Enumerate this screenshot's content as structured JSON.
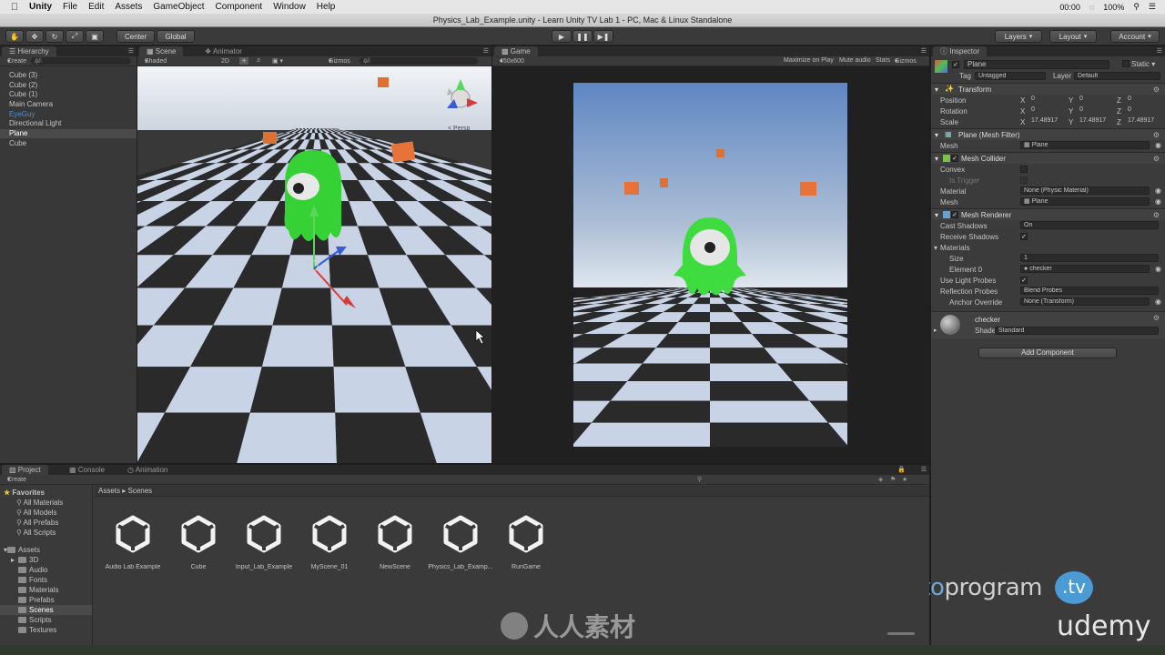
{
  "menubar": {
    "app": "Unity",
    "items": [
      "File",
      "Edit",
      "Assets",
      "GameObject",
      "Component",
      "Window",
      "Help"
    ],
    "clock": "00:00",
    "battery": "100%"
  },
  "window_title": "Physics_Lab_Example.unity - Learn Unity TV Lab 1 - PC, Mac & Linux Standalone",
  "toolbar": {
    "pivot": "Center",
    "space": "Global",
    "layers": "Layers",
    "layout": "Layout",
    "account": "Account"
  },
  "hierarchy": {
    "tab": "Hierarchy",
    "create": "Create",
    "search_placeholder": "All",
    "items": [
      "Cube (3)",
      "Cube (2)",
      "Cube (1)",
      "Main Camera",
      "EyeGuy",
      "Directional Light",
      "Plane",
      "Cube"
    ],
    "selected": "Plane",
    "prefab_item": "EyeGuy"
  },
  "scene": {
    "tabs": [
      "Scene",
      "Animator"
    ],
    "shading": "Shaded",
    "mode_2d": "2D",
    "gizmos": "Gizmos",
    "search_placeholder": "All",
    "persp": "Persp"
  },
  "game": {
    "tab": "Game",
    "resolution": "450x600",
    "options": [
      "Maximize on Play",
      "Mute audio",
      "Stats",
      "Gizmos"
    ]
  },
  "inspector": {
    "tab": "Inspector",
    "object_name": "Plane",
    "static": "Static",
    "tag_label": "Tag",
    "tag_value": "Untagged",
    "layer_label": "Layer",
    "layer_value": "Default",
    "transform": {
      "title": "Transform",
      "rows": [
        {
          "label": "Position",
          "x": "0",
          "y": "0",
          "z": "0"
        },
        {
          "label": "Rotation",
          "x": "0",
          "y": "0",
          "z": "0"
        },
        {
          "label": "Scale",
          "x": "17.48917",
          "y": "17.48917",
          "z": "17.48917"
        }
      ]
    },
    "mesh_filter": {
      "title": "Plane (Mesh Filter)",
      "mesh_label": "Mesh",
      "mesh_value": "Plane"
    },
    "mesh_collider": {
      "title": "Mesh Collider",
      "convex": "Convex",
      "is_trigger": "Is Trigger",
      "material_label": "Material",
      "material_value": "None (Physic Material)",
      "mesh_label": "Mesh",
      "mesh_value": "Plane"
    },
    "mesh_renderer": {
      "title": "Mesh Renderer",
      "cast_shadows_label": "Cast Shadows",
      "cast_shadows_value": "On",
      "receive_shadows": "Receive Shadows",
      "materials": "Materials",
      "size_label": "Size",
      "size_value": "1",
      "element_label": "Element 0",
      "element_value": "checker",
      "light_probes": "Use Light Probes",
      "reflection_label": "Reflection Probes",
      "reflection_value": "Blend Probes",
      "anchor_label": "Anchor Override",
      "anchor_value": "None (Transform)"
    },
    "material": {
      "name": "checker",
      "shader_label": "Shader",
      "shader_value": "Standard"
    },
    "add_component": "Add Component"
  },
  "project": {
    "tabs": [
      "Project",
      "Console",
      "Animation"
    ],
    "create": "Create",
    "favorites_title": "Favorites",
    "favorites": [
      "All Materials",
      "All Models",
      "All Prefabs",
      "All Scripts"
    ],
    "assets_title": "Assets",
    "folders": [
      "3D",
      "Audio",
      "Fonts",
      "Materials",
      "Prefabs",
      "Scenes",
      "Scripts",
      "Textures"
    ],
    "selected_folder": "Scenes",
    "breadcrumb": [
      "Assets",
      "Scenes"
    ],
    "scene_assets": [
      "Audio Lab Example",
      "Cube",
      "Input_Lab_Example",
      "MyScene_01",
      "NewScene",
      "Physics_Lab_Examp...",
      "RunGame"
    ]
  },
  "branding": {
    "learnto": "learnto",
    "program": "program",
    "tv": ".tv",
    "udemy": "udemy",
    "watermark": "人人素材"
  },
  "colors": {
    "sky_top": "#5f86c2",
    "sky_horizon": "#dfe6ee",
    "checker_light": "#c8d3e6",
    "checker_dark": "#2a2a2a",
    "character_green": "#3fdc3f",
    "cube_orange": "#e8733a",
    "selection": "#4a4a4a"
  }
}
